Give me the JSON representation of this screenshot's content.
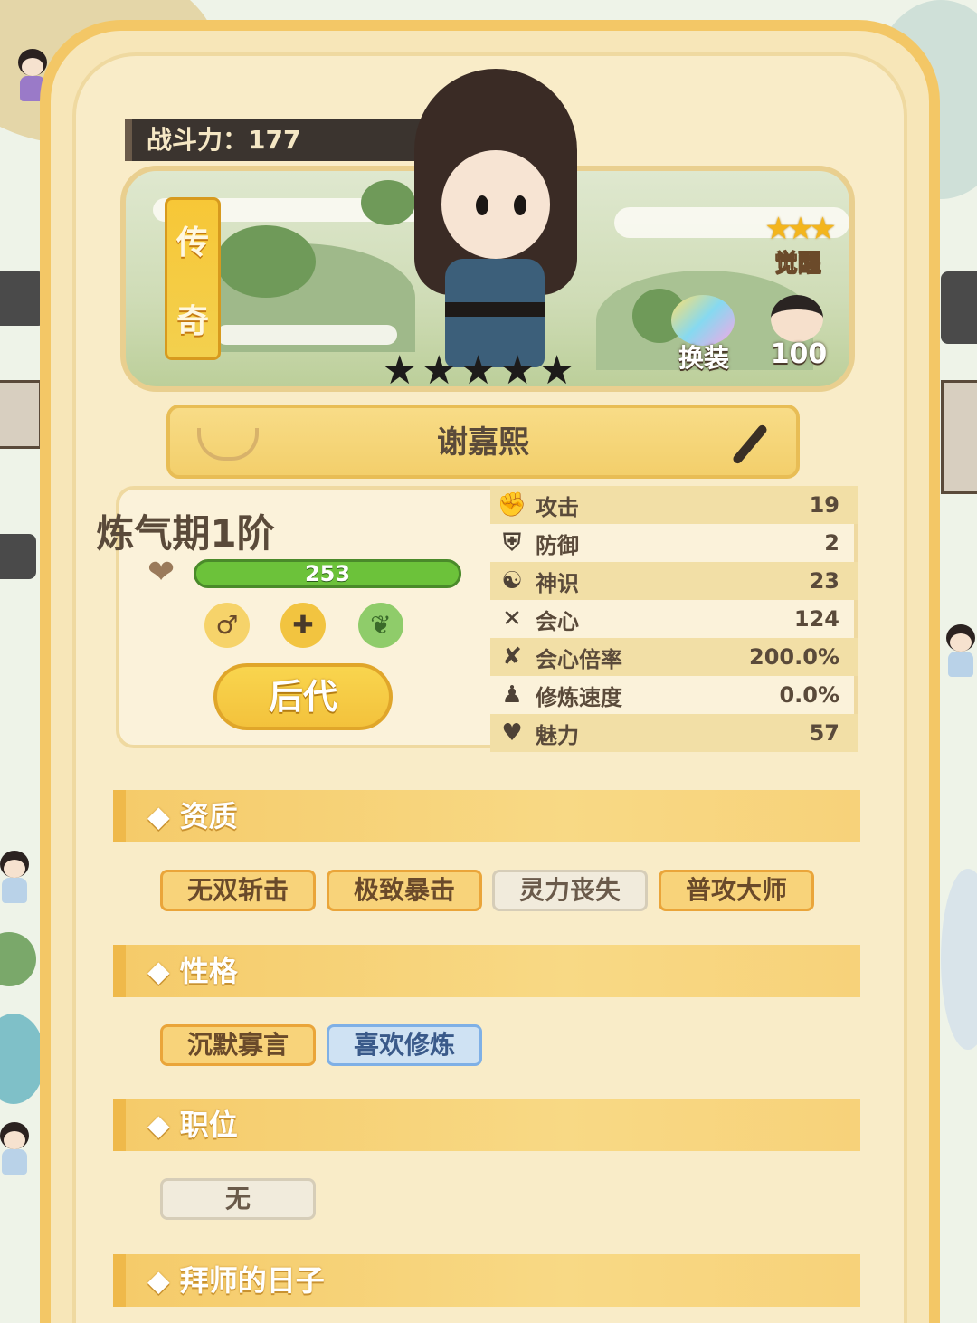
{
  "power": {
    "label": "战斗力：177"
  },
  "hero": {
    "rarity_chars": [
      "传",
      "奇"
    ],
    "stars": [
      "★",
      "★",
      "★",
      "★",
      "★"
    ],
    "awaken_label": "觉醒",
    "outfit_label": "换装",
    "child_count": "100",
    "name": "谢嘉熙"
  },
  "cultivation": {
    "realm": "炼气期1阶",
    "hp": "253",
    "descendants_button": "后代"
  },
  "stats": [
    {
      "icon": "fist-icon",
      "glyph": "✊",
      "label": "攻击",
      "value": "19"
    },
    {
      "icon": "shield-icon",
      "glyph": "⛨",
      "label": "防御",
      "value": "2"
    },
    {
      "icon": "spirit-icon",
      "glyph": "☯",
      "label": "神识",
      "value": "23"
    },
    {
      "icon": "crossed-swords-icon",
      "glyph": "✕",
      "label": "会心",
      "value": "124"
    },
    {
      "icon": "crit-rate-icon",
      "glyph": "✘",
      "label": "会心倍率",
      "value": "200.0%"
    },
    {
      "icon": "meditation-icon",
      "glyph": "♟",
      "label": "修炼速度",
      "value": "0.0%"
    },
    {
      "icon": "heart-icon",
      "glyph": "♥",
      "label": "魅力",
      "value": "57"
    }
  ],
  "sections": {
    "aptitude": {
      "title": "◆ 资质",
      "tags": [
        "无双斩击",
        "极致暴击",
        "灵力丧失",
        "普攻大师"
      ]
    },
    "personality": {
      "title": "◆ 性格",
      "tags": [
        "沉默寡言",
        "喜欢修炼"
      ]
    },
    "position": {
      "title": "◆ 职位",
      "tags": [
        "无"
      ]
    },
    "master_days": {
      "title": "◆ 拜师的日子"
    }
  },
  "colors": {
    "accent": "#f3c766",
    "hp_bar": "#6cc23a",
    "text": "#5a4a3a"
  }
}
